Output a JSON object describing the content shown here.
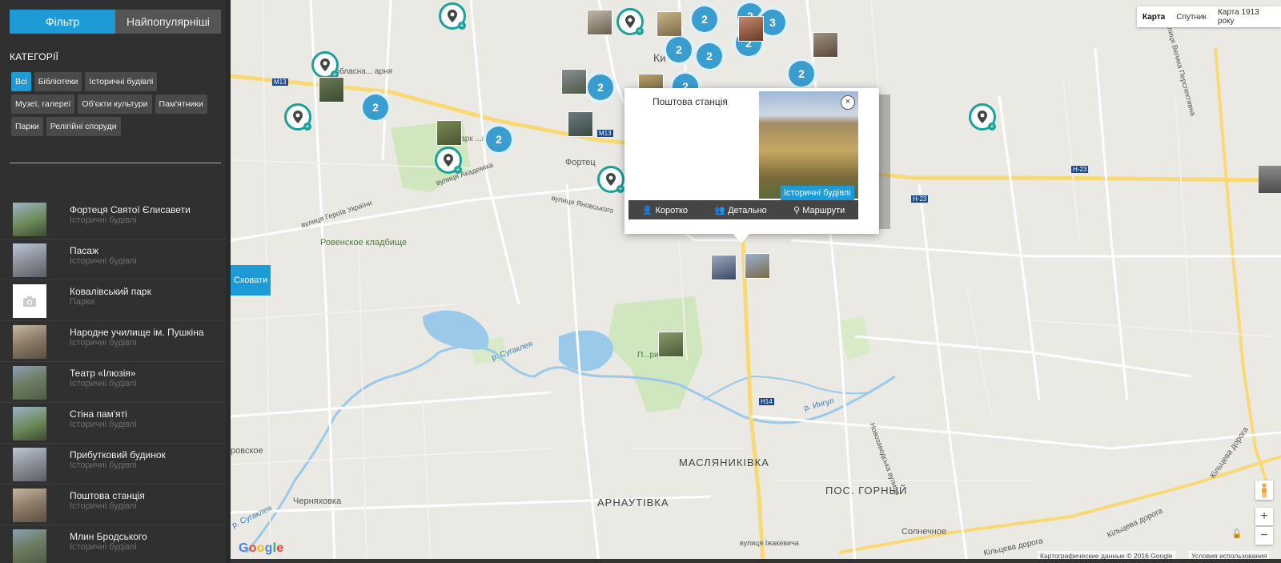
{
  "sidebar": {
    "tabs": [
      {
        "label": "Фільтр",
        "active": true
      },
      {
        "label": "Найпопулярніші",
        "active": false
      }
    ],
    "categories_title": "КАТЕГОРІЇ",
    "categories": [
      {
        "label": "Всі",
        "active": true
      },
      {
        "label": "Бібліотеки",
        "active": false
      },
      {
        "label": "Історичні будівлі",
        "active": false
      },
      {
        "label": "Музеї, галереї",
        "active": false
      },
      {
        "label": "Об'єкти культури",
        "active": false
      },
      {
        "label": "Пам'ятники",
        "active": false
      },
      {
        "label": "Парки",
        "active": false
      },
      {
        "label": "Релігійні споруди",
        "active": false
      }
    ],
    "items": [
      {
        "title": "Фортеця Святої Єлисавети",
        "category": "Історичні будівлі"
      },
      {
        "title": "Пасаж",
        "category": "Історичні будівлі"
      },
      {
        "title": "Ковалівський парк",
        "category": "Парки"
      },
      {
        "title": "Народне училище ім. Пушкіна",
        "category": "Історичні будівлі"
      },
      {
        "title": "Театр «Ілюзія»",
        "category": "Історичні будівлі"
      },
      {
        "title": "Стіна пам'яті",
        "category": "Історичні будівлі"
      },
      {
        "title": "Прибутковий будинок",
        "category": "Історичні будівлі"
      },
      {
        "title": "Поштова станція",
        "category": "Історичні будівлі"
      },
      {
        "title": "Млин Бродського",
        "category": "Історичні будівлі"
      }
    ]
  },
  "map": {
    "hide_button": "Сховати",
    "map_types": [
      {
        "label": "Карта",
        "active": true
      },
      {
        "label": "Спутник",
        "active": false
      },
      {
        "label": "Карта 1913 року",
        "active": false
      }
    ],
    "popup": {
      "title": "Поштова станція",
      "badge": "Історичні будівлі",
      "close": "×",
      "actions": [
        "Коротко",
        "Детально",
        "Маршрути"
      ]
    },
    "clusters": [
      "2",
      "2",
      "2",
      "2",
      "2",
      "2",
      "2",
      "2",
      "2",
      "3",
      "2"
    ],
    "labels": {
      "cemetery": "Ровенское кладбище",
      "fortress": "Фортец",
      "masl": "МАСЛЯНИКІВКА",
      "arn": "АРНАУТІВКА",
      "gorny": "ПОС. ГОРНЫЙ",
      "solnech": "Солнечное",
      "chern": "Черняховка",
      "ki": "Ки",
      "rovskoe": "ровское",
      "hospital": "Кр... обласна... арня",
      "park": "...опарк ...кий",
      "parku": "П...ри",
      "road_m13a": "M13",
      "road_m13b": "M13",
      "road_h23a": "H-23",
      "road_h23b": "H-23",
      "road_h14": "H14",
      "river1": "р. Сугаклея",
      "river2": "р. Ингул",
      "river3": "р. Сугаклея",
      "street1": "вулиця Академіка",
      "street2": "вулиця Героїв України",
      "street3": "вулиця Яновського",
      "street4": "Новозаводська вулиця",
      "street5": "вулиця Іжакевича",
      "street6": "Кільцева дорога",
      "street7": "Кільцева дорога",
      "street8": "Кільцева дорога",
      "street9": "вулиця Велика Перспективна"
    },
    "footer_data": "Картографические данные © 2016 Google",
    "footer_terms": "Условия использования",
    "google": "Google",
    "zoom_in": "+",
    "zoom_out": "−"
  },
  "colors": {
    "accent": "#1c9bd6",
    "sidebar_bg": "#303030",
    "cluster": "#3a9dd0",
    "pin": "#1aa19a"
  }
}
